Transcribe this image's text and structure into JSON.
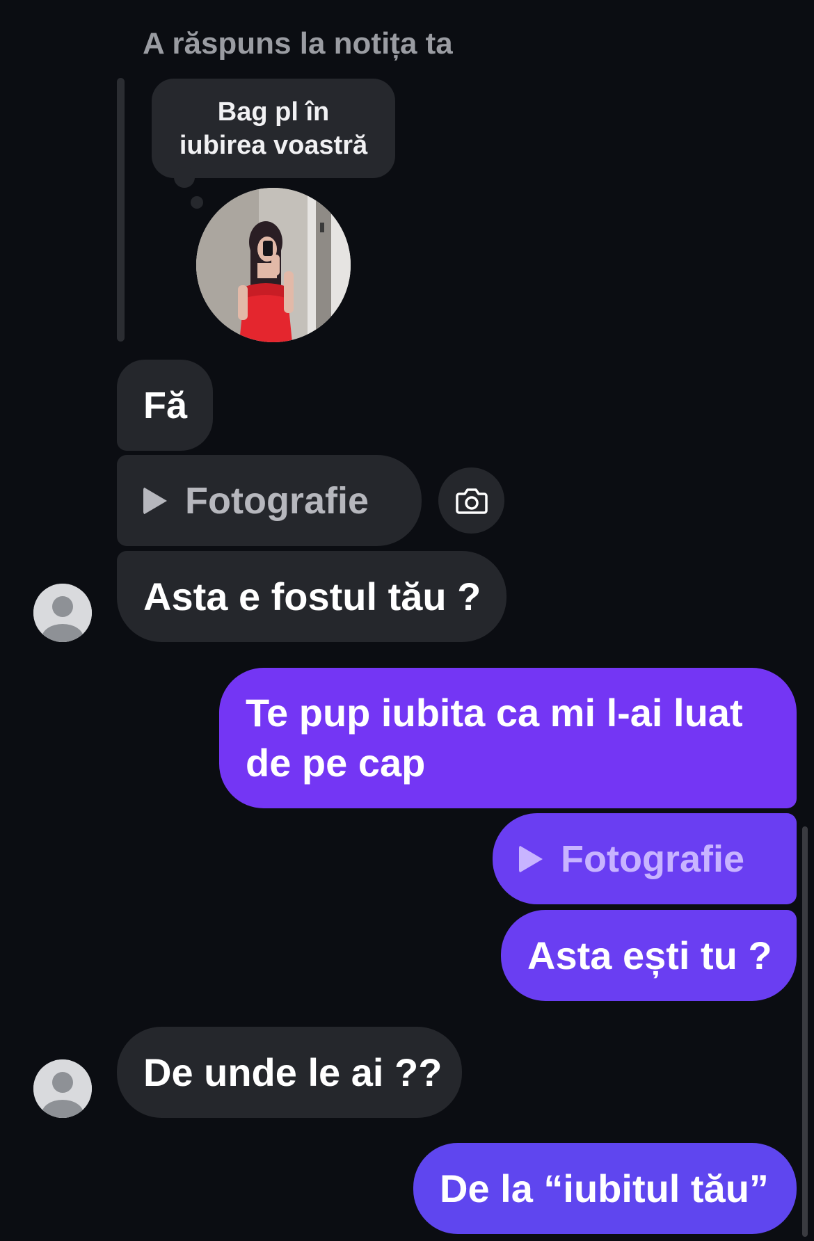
{
  "reply": {
    "header": "A răspuns la notița ta",
    "note_line1": "Bag pl în",
    "note_line2": "iubirea voastră"
  },
  "messages": {
    "incoming": [
      {
        "text": "Fă"
      },
      {
        "text": "Fotografie",
        "type": "photo"
      },
      {
        "text": "Asta e fostul tău ?"
      },
      {
        "text": "De unde le ai ??"
      }
    ],
    "outgoing": [
      {
        "text": "Te pup iubita ca mi  l-ai luat de pe cap"
      },
      {
        "text": "Fotografie",
        "type": "photo"
      },
      {
        "text": "Asta ești tu ?"
      },
      {
        "text": "De la “iubitul tău”"
      }
    ]
  },
  "icons": {
    "camera": "camera-icon",
    "play": "play-icon",
    "avatar": "user-avatar-icon"
  },
  "colors": {
    "background": "#0b0d12",
    "incoming_bubble": "#25272c",
    "outgoing_bubble": "#7436f4",
    "outgoing_bubble_late": "#5f46ef",
    "muted_text": "#9a9ca2"
  }
}
